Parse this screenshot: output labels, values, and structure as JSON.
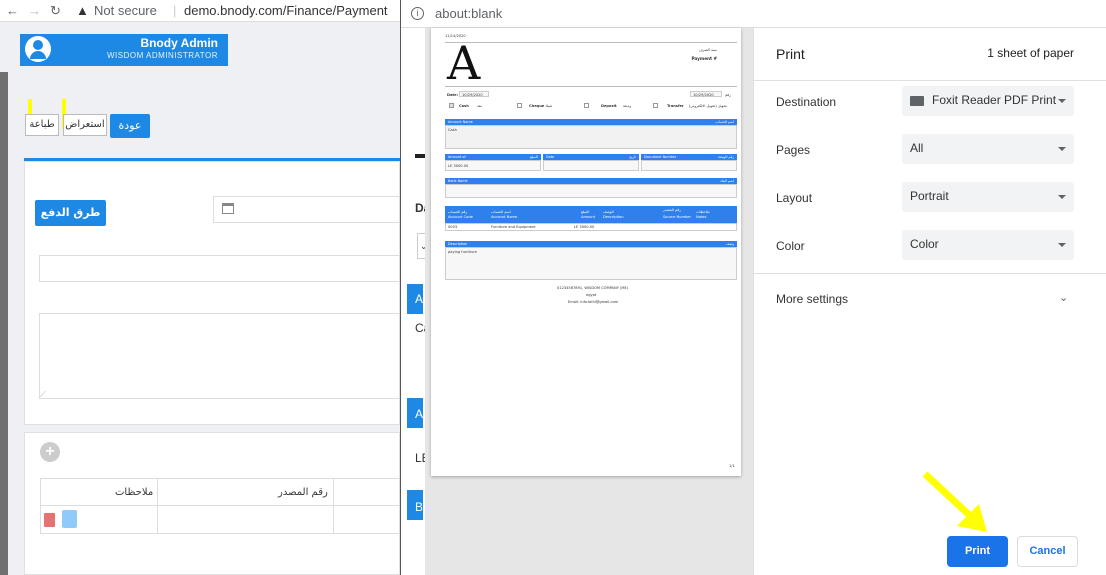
{
  "left_window": {
    "url_warning": "Not secure",
    "url": "demo.bnody.com/Finance/Payment",
    "user": {
      "name": "Bnody Admin",
      "role": "WISDOM ADMINISTRATOR"
    },
    "buttons": {
      "print": "طباعة",
      "preview": "استعراض",
      "back": "عودة",
      "payment_methods": "طرق الدفع $"
    },
    "table_headers": {
      "notes": "ملاحظات",
      "source_number": "رقم المصدر"
    },
    "partial_labels": {
      "da": "Da",
      "ac": "Ac",
      "ca": "Ca",
      "ar": "Ar",
      "le": "LE",
      "ba": "Ba"
    }
  },
  "right_window": {
    "url": "about:blank",
    "preview": {
      "date": "11/14/2020",
      "big_letter": "A",
      "voucher_ar": "سند الصرف",
      "payment_no": "Payment #",
      "date_label": "Date:",
      "date_value": "10/29/2020",
      "no_value": "10/29/2020",
      "no_label_ar": "رقم",
      "methods": [
        {
          "en": "Cash",
          "ar": "نقد",
          "checked": true
        },
        {
          "en": "Cheque",
          "ar": "شيك",
          "checked": false
        },
        {
          "en": "Deposit",
          "ar": "وديعة",
          "checked": false
        },
        {
          "en": "Transfer",
          "ar": "تحويل (تحويل الالكتروني)",
          "checked": false
        }
      ],
      "account_name_en": "Account Name",
      "account_name_ar": "اسم الحساب",
      "account_value": "Cash",
      "amount_en": "Amount of",
      "amount_ar": "المبلغ",
      "amount_value": "LE 3000.00",
      "date_en": "Date",
      "date_ar": "تاريخ",
      "doc_en": "Document Number",
      "doc_ar": "رقم الوثيقة",
      "bank_en": "Bank Name",
      "bank_ar": "اسم البنك",
      "table_cols": [
        {
          "ar": "رقم الحساب",
          "en": "Account Code"
        },
        {
          "ar": "اسم الحساب",
          "en": "Account Name"
        },
        {
          "ar": "المبلغ",
          "en": "Amount"
        },
        {
          "ar": "الوصف",
          "en": "Description"
        },
        {
          "ar": "رقم المصدر",
          "en": "Source Number"
        },
        {
          "ar": "ملاحظات",
          "en": "Notes"
        }
      ],
      "table_row": {
        "code": "0003",
        "name": "Furniture and Equipment",
        "amount": "LE 3000.00"
      },
      "description_en": "Description",
      "description_ar": "وصف",
      "description_value": "paying furniture",
      "footer_company": "01234567891, WISDOM COMPANY (ME)",
      "footer_country": "egypt",
      "footer_email": "Email: info.bkhl@gmail.com",
      "page_no": "1/1"
    },
    "settings": {
      "title": "Print",
      "sheets": "1 sheet of paper",
      "destination_label": "Destination",
      "destination_value": "Foxit Reader PDF Print",
      "pages_label": "Pages",
      "pages_value": "All",
      "layout_label": "Layout",
      "layout_value": "Portrait",
      "color_label": "Color",
      "color_value": "Color",
      "more_settings": "More settings",
      "print_button": "Print",
      "cancel_button": "Cancel"
    }
  },
  "colors": {
    "accent": "#1e88e5",
    "chrome_blue": "#1a73e8",
    "highlight": "#ffff00"
  }
}
